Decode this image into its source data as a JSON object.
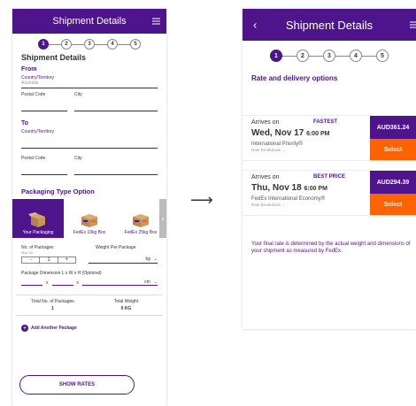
{
  "left": {
    "header": {
      "title": "Shipment Details"
    },
    "steps": [
      "1",
      "2",
      "3",
      "4",
      "5"
    ],
    "section_title": "Shipment Details",
    "from": {
      "label": "From",
      "country_label": "Country/Territory",
      "country_value": "Australia",
      "postal_label": "Postal Code",
      "city_label": "City"
    },
    "to": {
      "label": "To",
      "country_label": "Country/Territory",
      "postal_label": "Postal Code",
      "city_label": "City"
    },
    "packaging": {
      "title": "Packaging Type Option",
      "options": [
        "Your Packaging",
        "FedEx 10kg Box",
        "FedEx 25kg Box"
      ]
    },
    "packages": {
      "num_label": "No. of Packages",
      "max_label": "Max 40",
      "minus": "-",
      "count": "1",
      "plus": "+",
      "weight_label": "Weight Per Package",
      "weight_unit": "kg",
      "dim_label": "Package Dimension L x W x H (Optional)",
      "x1": "x",
      "x2": "x",
      "dim_unit": "cm"
    },
    "totals": {
      "num_label": "Total No. of Packages",
      "num_value": "1",
      "weight_label": "Total Weight",
      "weight_value": "0 KG"
    },
    "add_package": "Add Another Package",
    "show_rates": "SHOW RATES"
  },
  "right": {
    "header": {
      "title": "Shipment Details"
    },
    "steps": [
      "1",
      "2",
      "3",
      "4",
      "5"
    ],
    "section_title": "Rate and delivery options",
    "rates": [
      {
        "arrives": "Arrives on",
        "tag": "FASTEST",
        "date": "Wed, Nov 17",
        "time": "6:00 PM",
        "service": "International Priority®",
        "breakdown": "Rate Breakdown",
        "price": "AUD361.24",
        "select": "Select"
      },
      {
        "arrives": "Arrives on",
        "tag": "BEST PRICE",
        "date": "Thu, Nov 18",
        "time": "6:00 PM",
        "service": "FedEx International Economy®",
        "breakdown": "Rate Breakdown",
        "price": "AUD294.39",
        "select": "Select"
      }
    ],
    "note": "Your final rate is determined by the actual weight and dimensions of your shipment as measured by FedEx."
  },
  "colors": {
    "brand": "#4d148c",
    "accent": "#ff6200"
  },
  "arrow": "⟶"
}
